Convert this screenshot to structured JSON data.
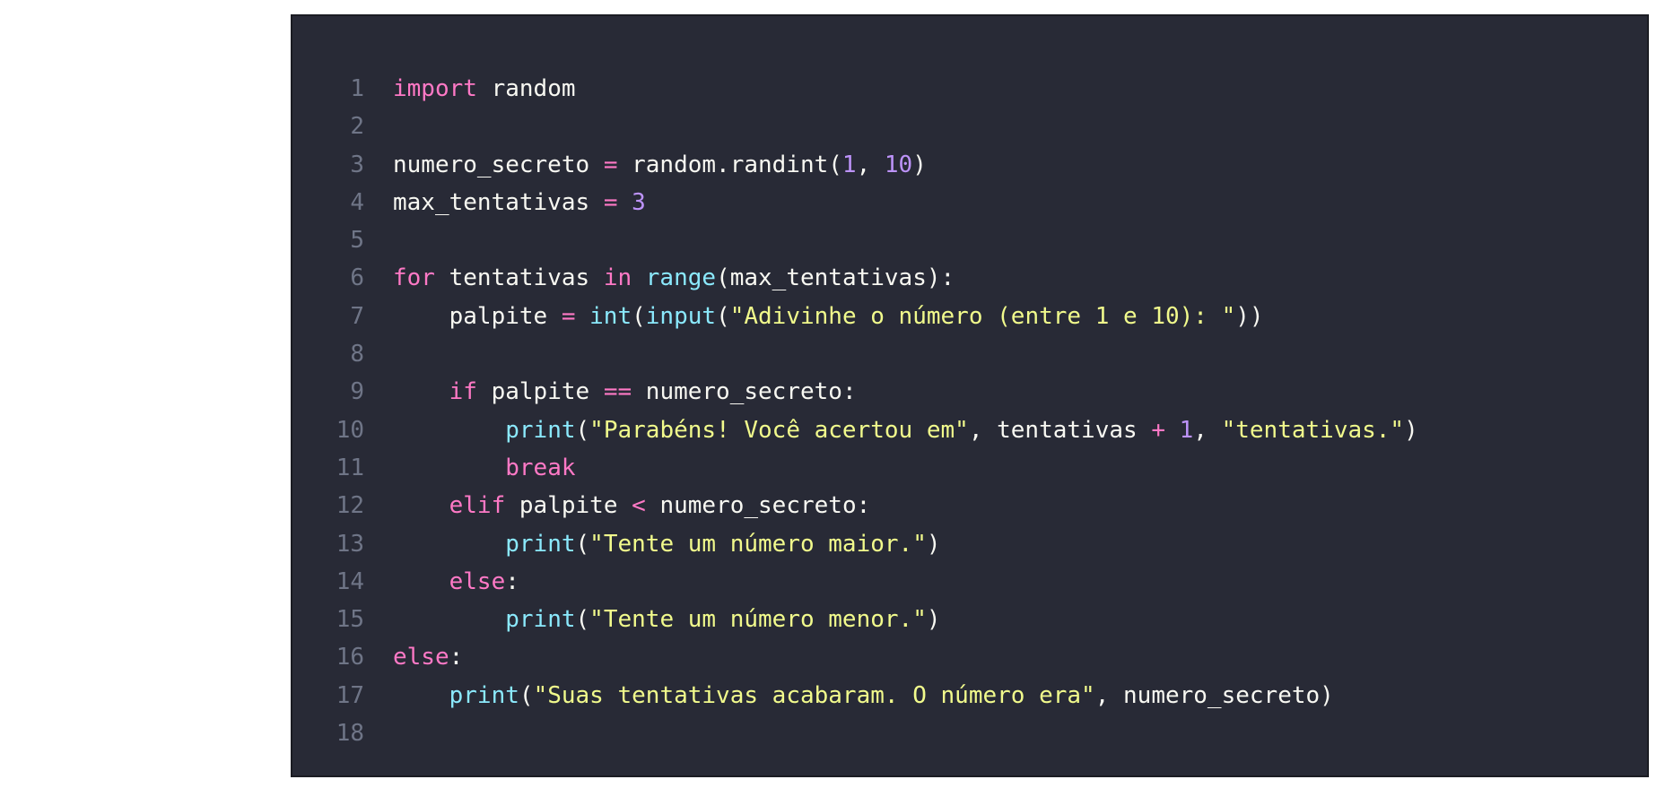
{
  "editor": {
    "colors": {
      "background": "#282a36",
      "line_number": "#6f7587",
      "text": "#f8f8f2",
      "keyword": "#ff79c6",
      "builtin": "#8be9fd",
      "number": "#bd93f9",
      "string": "#f1fa8c"
    },
    "lines": [
      {
        "number": "1",
        "tokens": [
          {
            "t": "keyword",
            "v": "import"
          },
          {
            "t": "text",
            "v": " random"
          }
        ]
      },
      {
        "number": "2",
        "tokens": []
      },
      {
        "number": "3",
        "tokens": [
          {
            "t": "text",
            "v": "numero_secreto "
          },
          {
            "t": "operator",
            "v": "="
          },
          {
            "t": "text",
            "v": " random.randint("
          },
          {
            "t": "number",
            "v": "1"
          },
          {
            "t": "text",
            "v": ", "
          },
          {
            "t": "number",
            "v": "10"
          },
          {
            "t": "text",
            "v": ")"
          }
        ]
      },
      {
        "number": "4",
        "tokens": [
          {
            "t": "text",
            "v": "max_tentativas "
          },
          {
            "t": "operator",
            "v": "="
          },
          {
            "t": "text",
            "v": " "
          },
          {
            "t": "number",
            "v": "3"
          }
        ]
      },
      {
        "number": "5",
        "tokens": []
      },
      {
        "number": "6",
        "tokens": [
          {
            "t": "keyword",
            "v": "for"
          },
          {
            "t": "text",
            "v": " tentativas "
          },
          {
            "t": "keyword",
            "v": "in"
          },
          {
            "t": "text",
            "v": " "
          },
          {
            "t": "builtin",
            "v": "range"
          },
          {
            "t": "text",
            "v": "(max_tentativas):"
          }
        ]
      },
      {
        "number": "7",
        "tokens": [
          {
            "t": "text",
            "v": "    palpite "
          },
          {
            "t": "operator",
            "v": "="
          },
          {
            "t": "text",
            "v": " "
          },
          {
            "t": "builtin",
            "v": "int"
          },
          {
            "t": "text",
            "v": "("
          },
          {
            "t": "builtin",
            "v": "input"
          },
          {
            "t": "text",
            "v": "("
          },
          {
            "t": "string",
            "v": "\"Adivinhe o número (entre 1 e 10): \""
          },
          {
            "t": "text",
            "v": "))"
          }
        ]
      },
      {
        "number": "8",
        "tokens": []
      },
      {
        "number": "9",
        "tokens": [
          {
            "t": "text",
            "v": "    "
          },
          {
            "t": "keyword",
            "v": "if"
          },
          {
            "t": "text",
            "v": " palpite "
          },
          {
            "t": "operator",
            "v": "=="
          },
          {
            "t": "text",
            "v": " numero_secreto:"
          }
        ]
      },
      {
        "number": "10",
        "tokens": [
          {
            "t": "text",
            "v": "        "
          },
          {
            "t": "builtin",
            "v": "print"
          },
          {
            "t": "text",
            "v": "("
          },
          {
            "t": "string",
            "v": "\"Parabéns! Você acertou em\""
          },
          {
            "t": "text",
            "v": ", tentativas "
          },
          {
            "t": "operator",
            "v": "+"
          },
          {
            "t": "text",
            "v": " "
          },
          {
            "t": "number",
            "v": "1"
          },
          {
            "t": "text",
            "v": ", "
          },
          {
            "t": "string",
            "v": "\"tentativas.\""
          },
          {
            "t": "text",
            "v": ")"
          }
        ]
      },
      {
        "number": "11",
        "tokens": [
          {
            "t": "text",
            "v": "        "
          },
          {
            "t": "keyword",
            "v": "break"
          }
        ]
      },
      {
        "number": "12",
        "tokens": [
          {
            "t": "text",
            "v": "    "
          },
          {
            "t": "keyword",
            "v": "elif"
          },
          {
            "t": "text",
            "v": " palpite "
          },
          {
            "t": "operator",
            "v": "<"
          },
          {
            "t": "text",
            "v": " numero_secreto:"
          }
        ]
      },
      {
        "number": "13",
        "tokens": [
          {
            "t": "text",
            "v": "        "
          },
          {
            "t": "builtin",
            "v": "print"
          },
          {
            "t": "text",
            "v": "("
          },
          {
            "t": "string",
            "v": "\"Tente um número maior.\""
          },
          {
            "t": "text",
            "v": ")"
          }
        ]
      },
      {
        "number": "14",
        "tokens": [
          {
            "t": "text",
            "v": "    "
          },
          {
            "t": "keyword",
            "v": "else"
          },
          {
            "t": "text",
            "v": ":"
          }
        ]
      },
      {
        "number": "15",
        "tokens": [
          {
            "t": "text",
            "v": "        "
          },
          {
            "t": "builtin",
            "v": "print"
          },
          {
            "t": "text",
            "v": "("
          },
          {
            "t": "string",
            "v": "\"Tente um número menor.\""
          },
          {
            "t": "text",
            "v": ")"
          }
        ]
      },
      {
        "number": "16",
        "tokens": [
          {
            "t": "keyword",
            "v": "else"
          },
          {
            "t": "text",
            "v": ":"
          }
        ]
      },
      {
        "number": "17",
        "tokens": [
          {
            "t": "text",
            "v": "    "
          },
          {
            "t": "builtin",
            "v": "print"
          },
          {
            "t": "text",
            "v": "("
          },
          {
            "t": "string",
            "v": "\"Suas tentativas acabaram. O número era\""
          },
          {
            "t": "text",
            "v": ", numero_secreto)"
          }
        ]
      },
      {
        "number": "18",
        "tokens": []
      }
    ]
  }
}
